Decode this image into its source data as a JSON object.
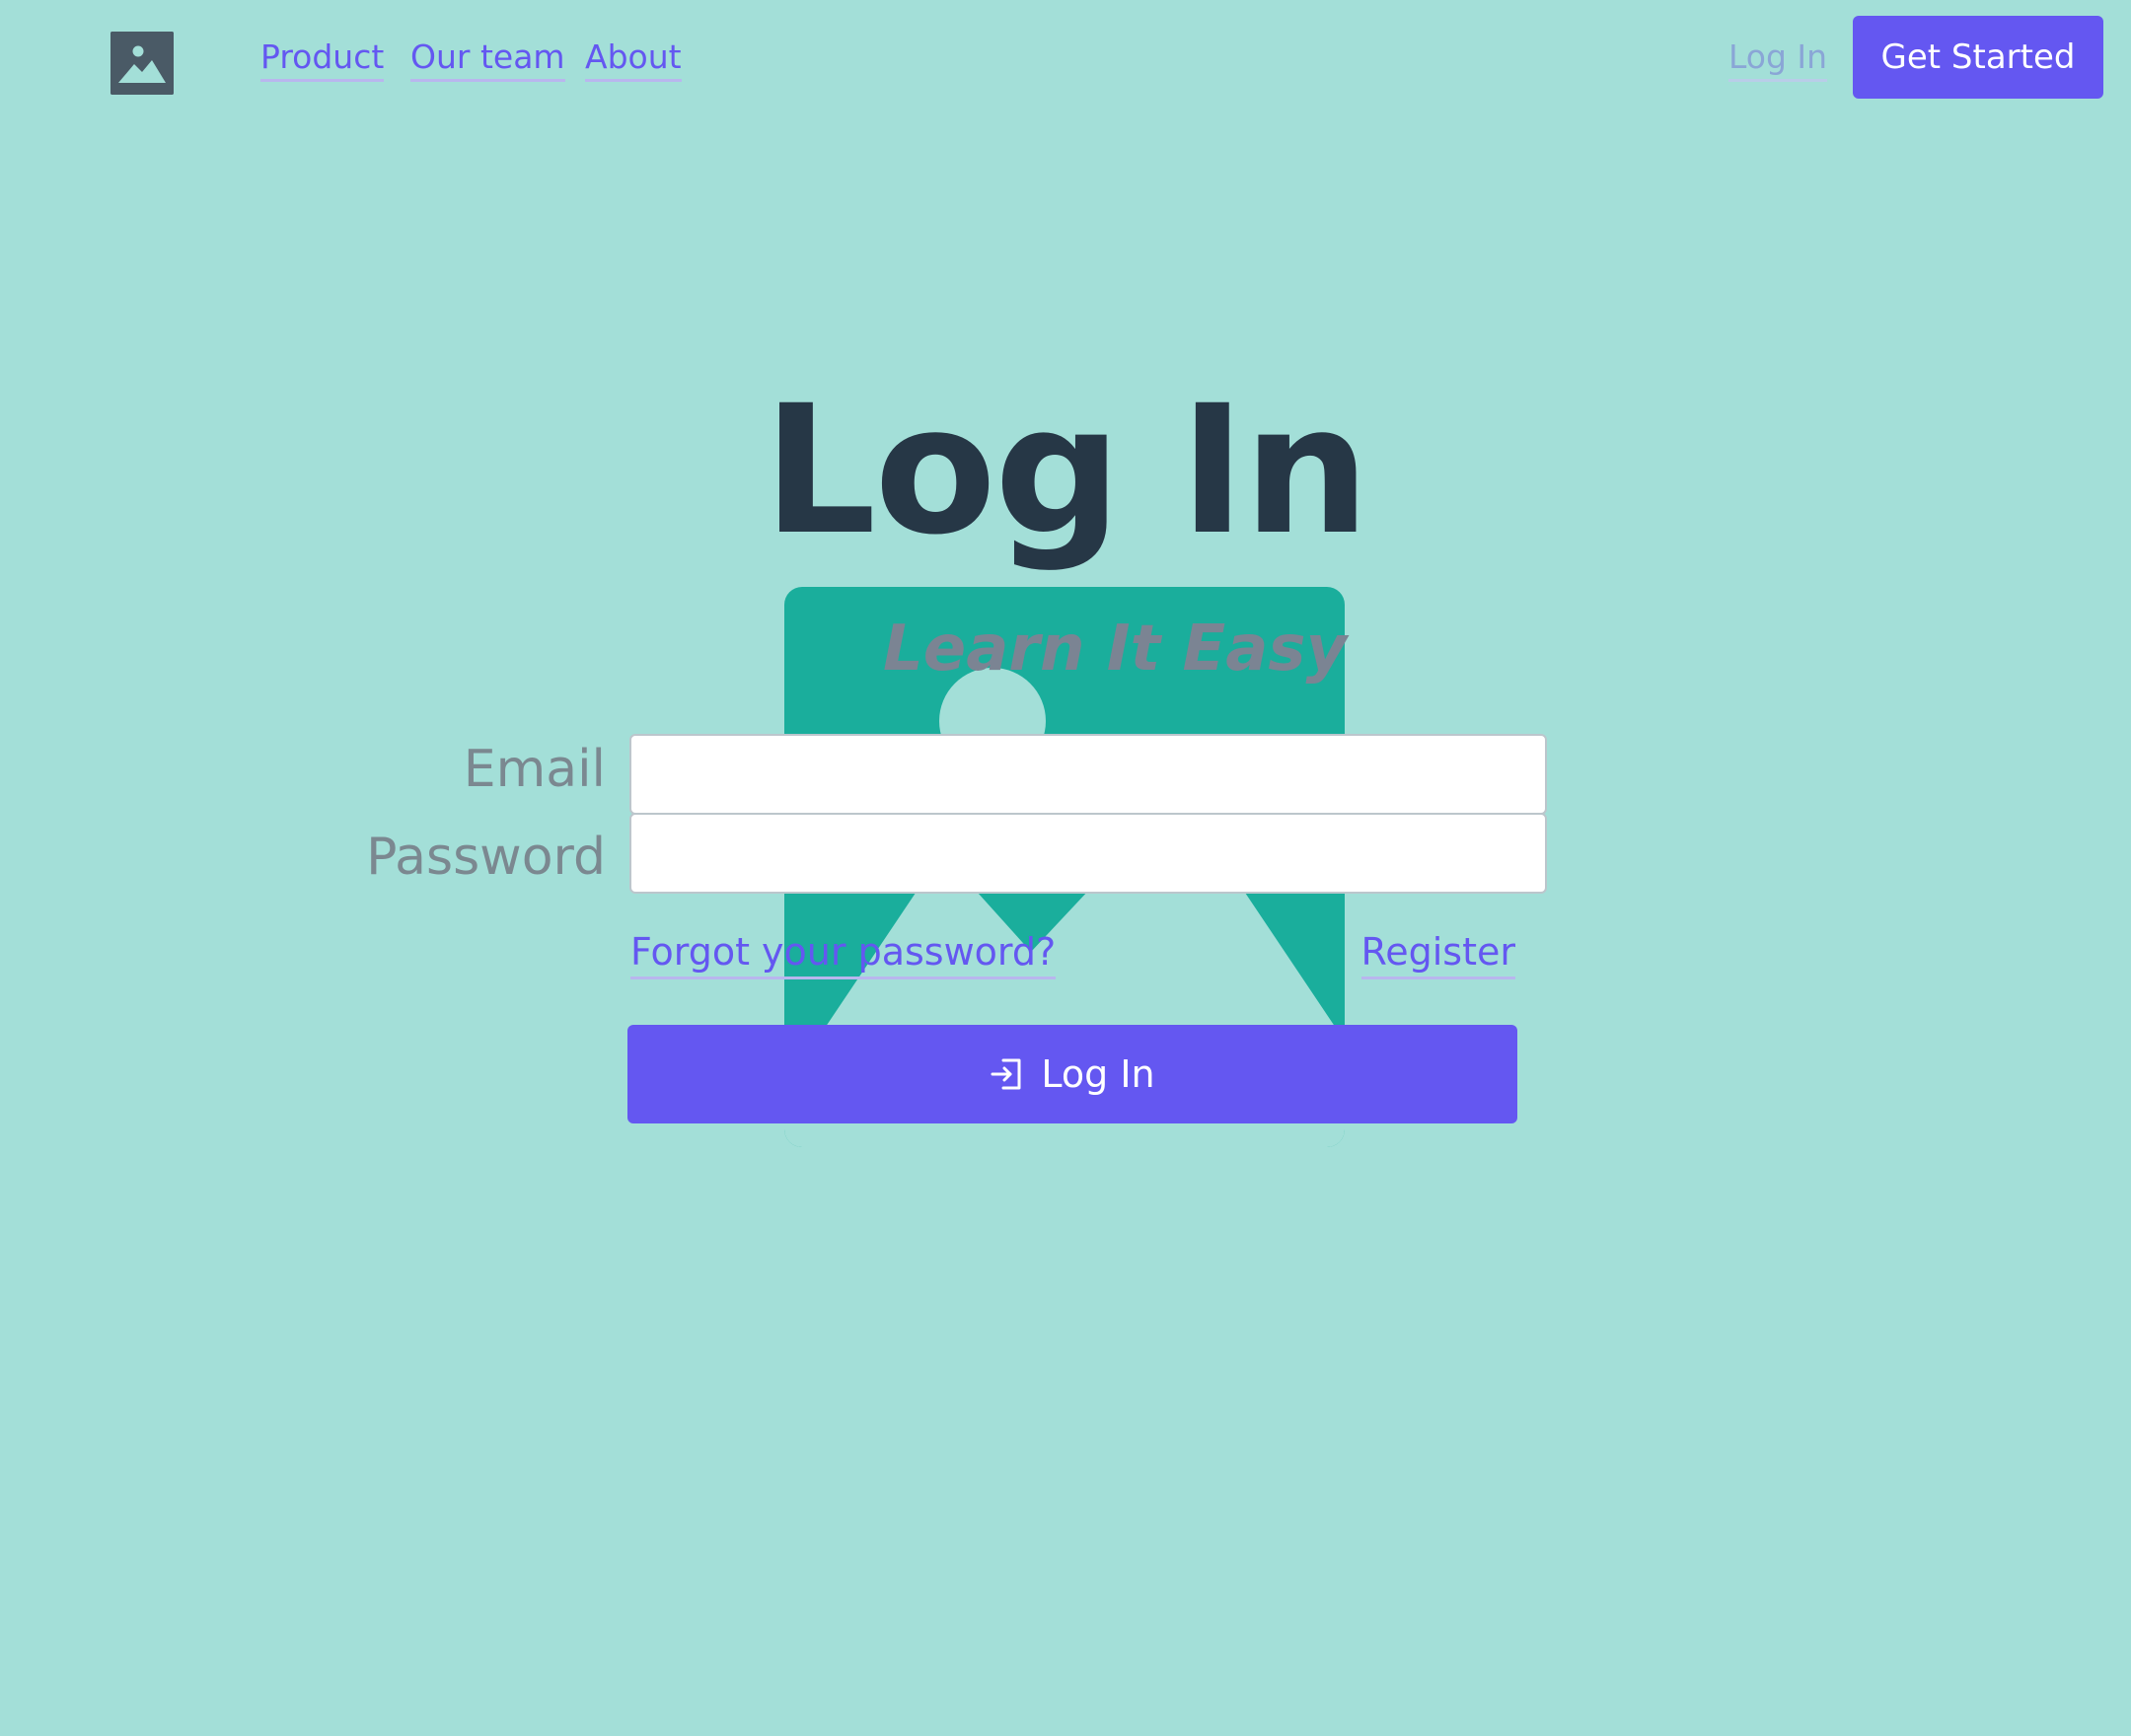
{
  "header": {
    "logo_icon": "image-icon",
    "nav": [
      {
        "label": "Product"
      },
      {
        "label": "Our team"
      },
      {
        "label": "About"
      }
    ],
    "login_label": "Log In",
    "get_started_label": "Get Started"
  },
  "main": {
    "title": "Log In",
    "illustration_caption": "Learn It Easy",
    "email_label": "Email",
    "email_value": "",
    "password_label": "Password",
    "password_value": "",
    "forgot_label": "Forgot your password?",
    "register_label": "Register",
    "login_button_label": "Log In",
    "login_button_icon": "login-icon"
  },
  "colors": {
    "background": "#a3dfd8",
    "accent": "#6457f1",
    "title": "#263746",
    "illustration": "#1aae9c"
  }
}
